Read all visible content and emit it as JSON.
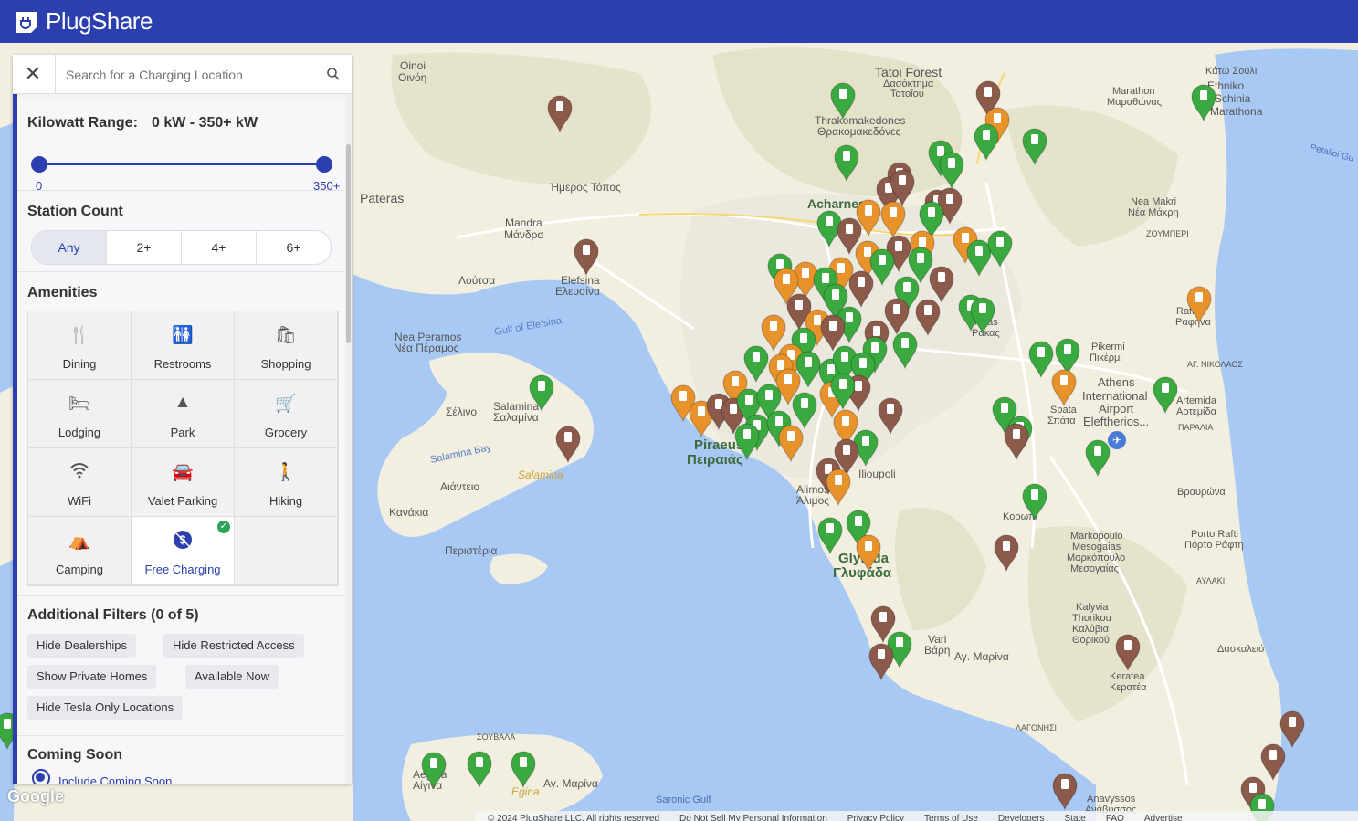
{
  "app": {
    "name": "PlugShare",
    "brand_color": "#2b3fae"
  },
  "search": {
    "placeholder": "Search for a Charging Location",
    "close_icon": "close-icon",
    "search_icon": "magnifier-icon"
  },
  "filters": {
    "kilowatt": {
      "label": "Kilowatt Range:",
      "value": "0 kW - 350+ kW",
      "min_label": "0",
      "max_label": "350+",
      "range_min": 0,
      "range_max": 1
    },
    "station_count": {
      "title": "Station Count",
      "options": [
        "Any",
        "2+",
        "4+",
        "6+"
      ],
      "selected": "Any"
    },
    "amenities": {
      "title": "Amenities",
      "items": [
        {
          "label": "Dining",
          "icon": "fork-knife-icon",
          "selected": false
        },
        {
          "label": "Restrooms",
          "icon": "restroom-icon",
          "selected": false
        },
        {
          "label": "Shopping",
          "icon": "shopping-bag-icon",
          "selected": false
        },
        {
          "label": "Lodging",
          "icon": "bed-icon",
          "selected": false
        },
        {
          "label": "Park",
          "icon": "tree-icon",
          "selected": false
        },
        {
          "label": "Grocery",
          "icon": "cart-icon",
          "selected": false
        },
        {
          "label": "WiFi",
          "icon": "wifi-icon",
          "selected": false
        },
        {
          "label": "Valet Parking",
          "icon": "valet-car-icon",
          "selected": false
        },
        {
          "label": "Hiking",
          "icon": "hiker-icon",
          "selected": false
        },
        {
          "label": "Camping",
          "icon": "tent-icon",
          "selected": false
        },
        {
          "label": "Free Charging",
          "icon": "free-dollar-icon",
          "selected": true
        }
      ]
    },
    "additional": {
      "title": "Additional Filters (0 of 5)",
      "chips": [
        "Hide Dealerships",
        "Hide Restricted Access",
        "Show Private Homes",
        "Available Now",
        "Hide Tesla Only Locations"
      ]
    },
    "coming_soon": {
      "title": "Coming Soon",
      "option": "Include Coming Soon"
    }
  },
  "map": {
    "labels": [
      "Oinoi",
      "Οινόη",
      "Tatoi Forest",
      "Δασόκτημα",
      "Τατοΐου",
      "Thrakomakedones",
      "Θρακομακεδόνες",
      "Pateras",
      "Ήμερος Τόπος",
      "Mandra",
      "Μάνδρα",
      "Λούτσα",
      "Elefsina",
      "Ελευσίνα",
      "Gulf of Elefsina",
      "Nea Peramos",
      "Νέα Πέραμος",
      "Salamina",
      "Σαλαμίνα",
      "Σέλινο",
      "Salamina Bay",
      "Αιάντειο",
      "Κανάκια",
      "Περιστέρια",
      "Piraeus",
      "Πειραιάς",
      "Glyfada",
      "Γλυφάδα",
      "Vari",
      "Βάρη",
      "Αγ. Μαρίνα",
      "Marathon",
      "Μαραθώνας",
      "Nea Makri",
      "Νέα Μάκρη",
      "ΖΟΥΜΠΕΡΙ",
      "Rafina",
      "Ραφήνα",
      "Pikermi",
      "Πικέρμι",
      "Athens International Airport Eleftherios...",
      "Spata",
      "Σπάτα",
      "Artemida",
      "Αρτεμίδα",
      "ΠΑΡΑΛΙΑ",
      "Βραυρώνα",
      "Markopoulo",
      "Mesogaias",
      "Μαρκόπουλο",
      "Μεσογαίας",
      "Porto Rafti",
      "Πόρτο Ράφτη",
      "ΑΥΛΑΚΙ",
      "Kalyvia",
      "Thorikou",
      "Καλύβια",
      "Θορικού",
      "Keratea",
      "Κερατέα",
      "Δασκαλειό",
      "ΛΑΓΟΝΗΣΙ",
      "Anavyssos",
      "Ανάβυσσος",
      "Saronic Gulf",
      "Σουβάλα",
      "Aegina",
      "Αίγινα",
      "Αγ. Μαρίνα",
      "Κάτω Σούλι",
      "Ethniko",
      "Schinia",
      "Marathona",
      "Petalioi Gulf",
      "ΑΓ. ΝΙΚΟΛΑΟΣ",
      "Acharnes",
      "Κορωπί",
      "Καλύβια",
      "Ilioupoli",
      "Alimos",
      "Άλιμος"
    ],
    "legend_colors": {
      "public": "#3aa93f",
      "restricted": "#8b5a4a",
      "fast": "#e8922b"
    }
  },
  "footer": {
    "copyright": "© 2024 PlugShare LLC. All rights reserved",
    "links": [
      "Do Not Sell My Personal Information",
      "Privacy Policy",
      "Terms of Use",
      "Developers",
      "State",
      "FAQ",
      "Advertise"
    ],
    "google": "Google"
  }
}
